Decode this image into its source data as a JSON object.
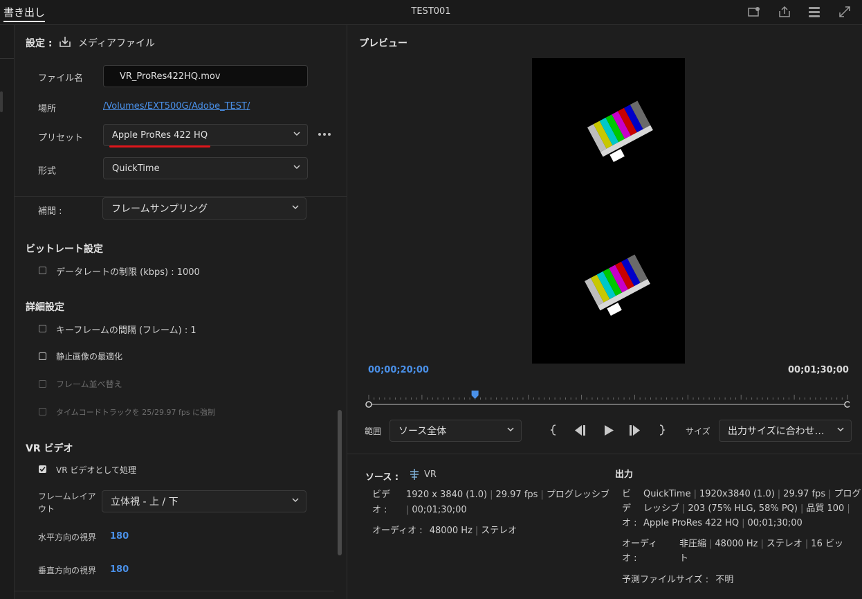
{
  "header": {
    "tab_label": "書き出し",
    "title": "TEST001",
    "icons": [
      "panel-icon",
      "share-icon",
      "queue-icon",
      "fullscreen-icon"
    ]
  },
  "settings": {
    "title": "設定 :",
    "destination": "メディアファイル",
    "filename_label": "ファイル名",
    "filename_value": "VR_ProRes422HQ.mov",
    "location_label": "場所",
    "location_value": "/Volumes/EXT500G/Adobe_TEST/",
    "preset_label": "プリセット",
    "preset_value": "Apple ProRes 422 HQ",
    "format_label": "形式",
    "format_value": "QuickTime",
    "interp_label": "補間 :",
    "interp_value": "フレームサンプリング"
  },
  "bitrate": {
    "heading": "ビットレート設定",
    "limit_label": "データレートの制限 (kbps) : 1000"
  },
  "advanced": {
    "heading": "詳細設定",
    "keyframe": "キーフレームの間隔 (フレーム) : 1",
    "optimize_stills": "静止画像の最適化",
    "frame_reorder": "フレーム並べ替え",
    "timecode": "タイムコードトラックを 25/29.97 fps に強制"
  },
  "vr": {
    "heading": "VR ビデオ",
    "process_label": "VR ビデオとして処理",
    "layout_label_1": "フレームレイア",
    "layout_label_2": "ウト",
    "layout_value": "立体視 - 上 / 下",
    "hfov_label": "水平方向の視界",
    "hfov_value": "180",
    "vfov_label": "垂直方向の視界",
    "vfov_value": "180"
  },
  "preview": {
    "title": "プレビュー",
    "current_tc": "00;00;20;00",
    "duration_tc": "00;01;30;00",
    "playhead_fraction": 0.222,
    "range_label": "範囲",
    "range_value": "ソース全体",
    "size_label": "サイズ",
    "size_value": "出力サイズに合わせ…",
    "accent": "#4a90e8"
  },
  "source": {
    "heading": "ソース :",
    "name": "VR",
    "video_label_1": "ビデ",
    "video_label_2": "オ :",
    "video_line1_a": "1920 x 3840 (1.0)",
    "video_line1_b": "29.97 fps",
    "video_line1_c": "プログレッシブ",
    "video_line2": "00;01;30;00",
    "audio_label": "オーディオ :",
    "audio_a": "48000 Hz",
    "audio_b": "ステレオ"
  },
  "output": {
    "heading": "出力",
    "video_label_1": "ビ",
    "video_label_2": "デ",
    "video_label_3": "オ :",
    "v1_a": "QuickTime",
    "v1_b": "1920x3840 (1.0)",
    "v1_c": "29.97 fps",
    "v1_d": "プログ",
    "v2_a": "レッシブ",
    "v2_b": "203 (75% HLG, 58% PQ)",
    "v2_c": "品質 100",
    "v3_a": "Apple ProRes 422 HQ",
    "v3_b": "00;01;30;00",
    "audio_label_1": "オーディ",
    "audio_label_2": "オ :",
    "a1_a": "非圧縮",
    "a1_b": "48000 Hz",
    "a1_c": "ステレオ",
    "a1_d": "16 ビッ",
    "a2": "ト",
    "filesize_label": "予測ファイルサイズ :",
    "filesize_value": "不明"
  }
}
